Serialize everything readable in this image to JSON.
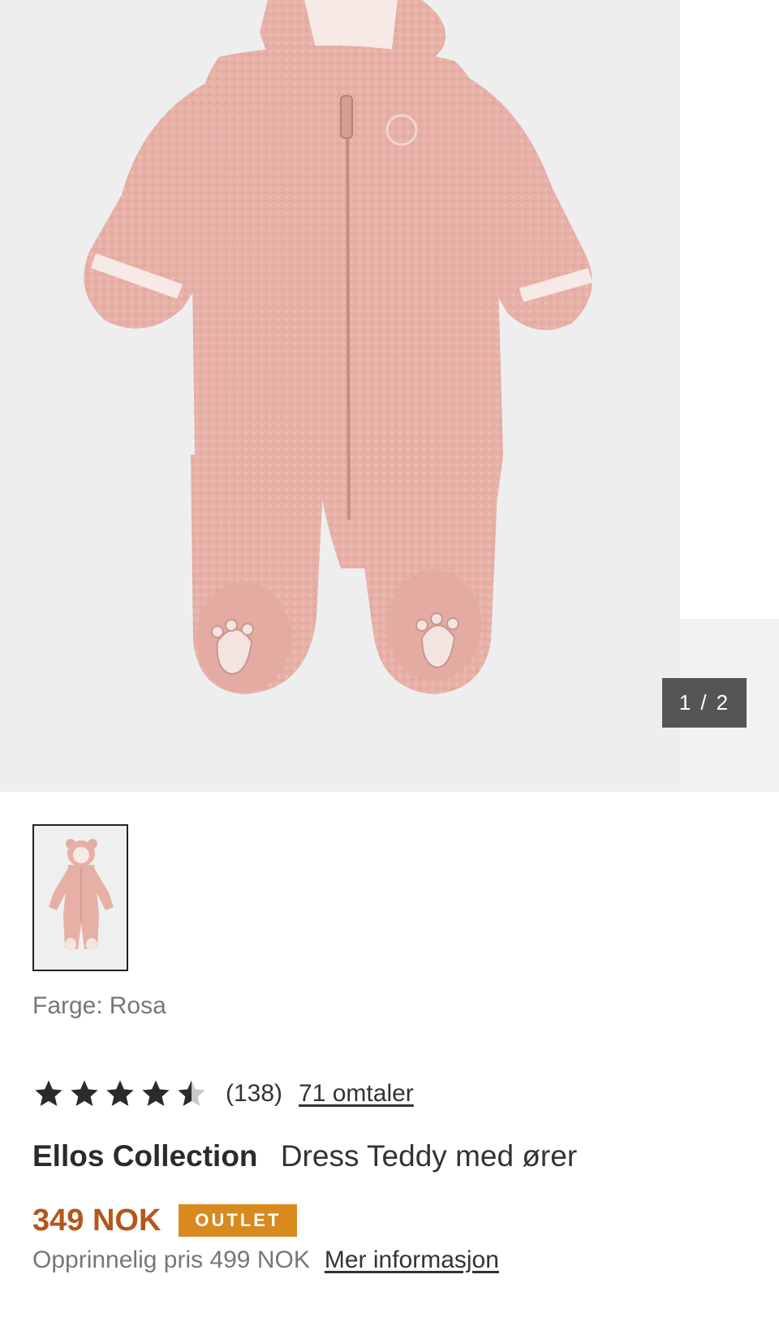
{
  "gallery": {
    "counter_current": "1",
    "counter_separator": "/",
    "counter_total": "2",
    "image_icon": "baby-teddy-suit-image",
    "image_color": "#e8b3a8"
  },
  "product": {
    "color_label": "Farge:",
    "color_value": "Rosa",
    "rating": 4.5,
    "rating_max": 5,
    "review_count": "(138)",
    "reviews_link": "71 omtaler",
    "brand": "Ellos Collection",
    "name": "Dress Teddy med ører",
    "price": "349 NOK",
    "badge": "OUTLET",
    "original_price_text": "Opprinnelig pris 499 NOK",
    "more_info_link": "Mer informasjon"
  },
  "colors": {
    "price": "#b5561b",
    "badge_bg": "#d98a1f",
    "star": "#2b2b2b",
    "star_empty": "#c8c8c8"
  }
}
